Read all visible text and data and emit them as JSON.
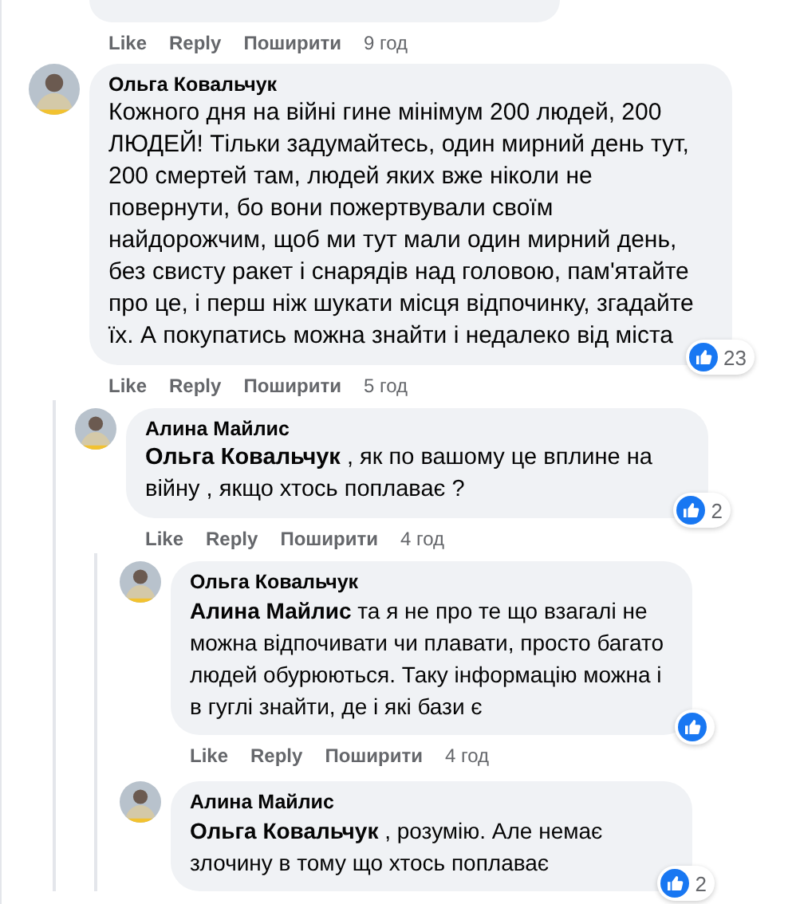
{
  "previous_comment": {
    "actions": [
      "Like",
      "Reply",
      "Поширити"
    ],
    "time": "9 год"
  },
  "comments": [
    {
      "author": "Ольга Ковальчук",
      "text": "Кожного дня на війні гине мінімум 200 людей, 200 ЛЮДЕЙ! Тільки задумайтесь, один мирний день тут, 200 смертей там, людей яких вже ніколи не повернути, бо вони пожертвували своїм найдорожчим, щоб ми тут мали один мирний день, без свисту ракет і снарядів над головою, пам'ятайте про це, і перш ніж шукати місця відпочинку, згадайте їх. А покупатись можна знайти і недалеко від міста",
      "reactions": "23",
      "actions": [
        "Like",
        "Reply",
        "Поширити"
      ],
      "time": "5 год",
      "replies": [
        {
          "author": "Алина Майлис",
          "mention": "Ольга Ковальчук",
          "text": " , як по вашому це вплине на війну , якщо хтось поплаває ?",
          "reactions": "2",
          "actions": [
            "Like",
            "Reply",
            "Поширити"
          ],
          "time": "4 год",
          "replies": [
            {
              "author": "Ольга Ковальчук",
              "mention": "Алина Майлис",
              "text": " та я не про те що взагалі не можна відпочивати чи плавати, просто багато людей обурюються. Таку інформацію можна і в гуглі знайти, де і які бази є",
              "liked": true,
              "actions": [
                "Like",
                "Reply",
                "Поширити"
              ],
              "time": "4 год"
            },
            {
              "author": "Алина Майлис",
              "mention": "Ольга Ковальчук",
              "text": " , розумію. Але немає злочину в тому що хтось поплаває",
              "reactions": "2"
            }
          ]
        }
      ]
    }
  ]
}
